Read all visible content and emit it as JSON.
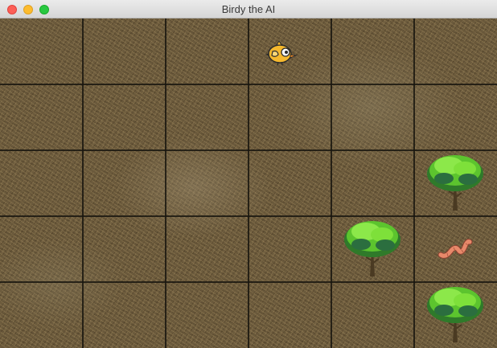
{
  "window": {
    "title": "Birdy the AI"
  },
  "board": {
    "columns": 6,
    "rows": 5,
    "entities": [
      {
        "type": "bird",
        "icon": "bird-icon",
        "col": 3,
        "row": 0
      },
      {
        "type": "tree",
        "icon": "tree-icon",
        "col": 5,
        "row": 2
      },
      {
        "type": "tree",
        "icon": "tree-icon",
        "col": 4,
        "row": 3
      },
      {
        "type": "worm",
        "icon": "worm-icon",
        "col": 5,
        "row": 3
      },
      {
        "type": "tree",
        "icon": "tree-icon",
        "col": 5,
        "row": 4
      }
    ]
  },
  "colors": {
    "grass": "#6b5a3c",
    "gridline": "#19160f",
    "tree_foliage": "#7ee03a",
    "tree_trunk": "#4a3a22",
    "bird_body": "#f5b82e",
    "worm": "#e8896a"
  }
}
